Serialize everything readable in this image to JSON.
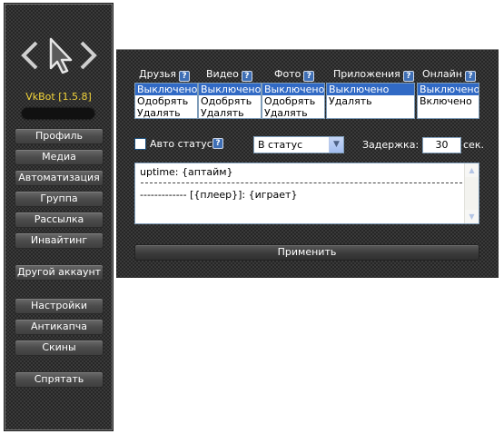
{
  "sidebar": {
    "version": "VkBot [1.5.8]",
    "buttons": [
      "Профиль",
      "Медиа",
      "Автоматизация",
      "Группа",
      "Рассылка",
      "Инвайтинг",
      "Другой аккаунт",
      "Настройки",
      "Антикапча",
      "Скины",
      "Спрятать"
    ]
  },
  "panel": {
    "columns": [
      {
        "title": "Друзья",
        "options": [
          "Выключено",
          "Одобрять",
          "Удалять"
        ],
        "selected": "Выключено"
      },
      {
        "title": "Видео",
        "options": [
          "Выключено",
          "Одобрять",
          "Удалять"
        ],
        "selected": "Выключено"
      },
      {
        "title": "Фото",
        "options": [
          "Выключено",
          "Одобрять",
          "Удалять"
        ],
        "selected": "Выключено"
      },
      {
        "title": "Приложения",
        "options": [
          "Выключено",
          "Удалять"
        ],
        "selected": "Выключено"
      },
      {
        "title": "Онлайн",
        "options": [
          "Выключено",
          "Включено"
        ],
        "selected": "Выключено"
      }
    ],
    "help_glyph": "?",
    "auto_status": {
      "label": "Авто статус?",
      "checked": false
    },
    "status_target": {
      "selected": "В статус"
    },
    "delay": {
      "label": "Задержка:",
      "value": "30",
      "unit": "сек."
    },
    "template": {
      "line1": "uptime: {аптайм}",
      "line2": "------------- [{плеер}]: {играет}"
    },
    "apply_label": "Применить"
  },
  "colors": {
    "version_text": "#f2d43a",
    "selection": "#316ac5",
    "help_icon": "#3f6fb5"
  },
  "icons": {
    "logo": "cursor-chevrons-logo",
    "help": "help-icon",
    "dropdown": "chevron-down-icon"
  }
}
